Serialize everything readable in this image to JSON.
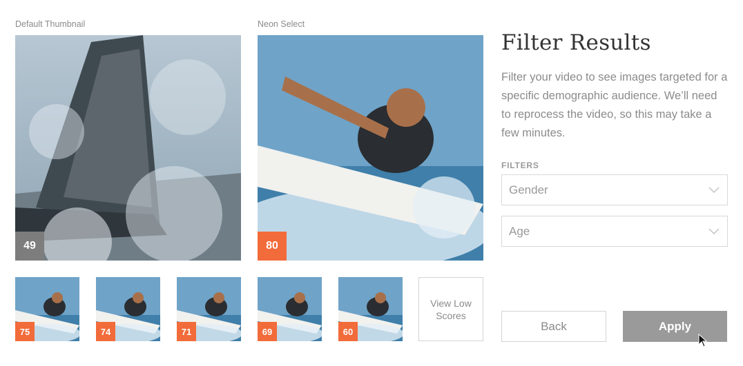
{
  "captions": {
    "default": "Default Thumbnail",
    "neon": "Neon Select"
  },
  "main_images": {
    "default": {
      "score": "49",
      "alt": "Sailboat with spray"
    },
    "neon": {
      "score": "80",
      "alt": "Surfer on wave"
    }
  },
  "thumbnails": [
    {
      "score": "75"
    },
    {
      "score": "74"
    },
    {
      "score": "71"
    },
    {
      "score": "69"
    },
    {
      "score": "60"
    }
  ],
  "view_low_scores": "View Low Scores",
  "panel": {
    "title": "Filter Results",
    "description": "Filter your video to see images targeted for a specific demographic audience. We’ll need to reprocess the video, so this may take a few minutes.",
    "filters_label": "FILTERS",
    "gender_placeholder": "Gender",
    "age_placeholder": "Age"
  },
  "buttons": {
    "back": "Back",
    "apply": "Apply"
  },
  "colors": {
    "score_orange": "#f26b3a",
    "score_grey": "#7d7d7d",
    "apply_bg": "#9a9a9a"
  }
}
